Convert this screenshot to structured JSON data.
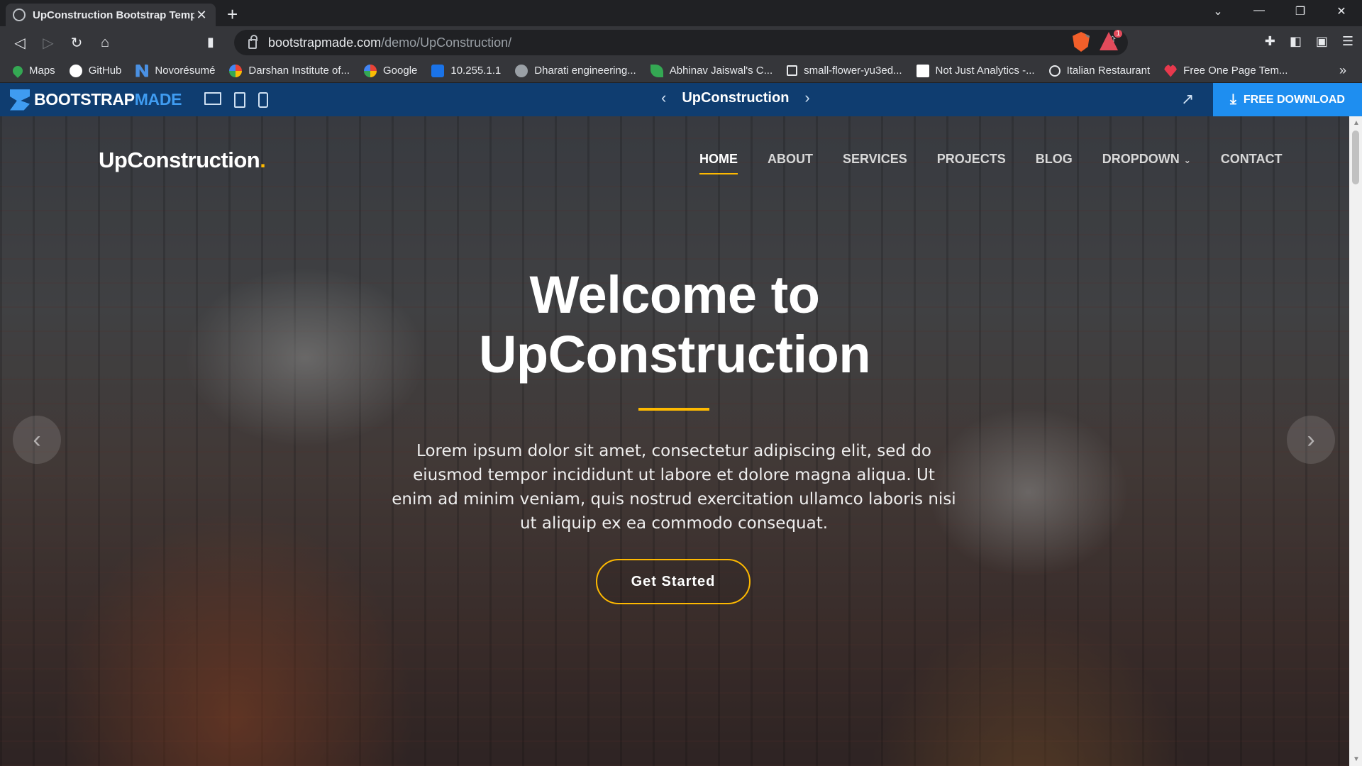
{
  "browser": {
    "tab_title": "UpConstruction Bootstrap Templa",
    "tab_close": "✕",
    "new_tab": "+",
    "url_host": "bootstrapmade.com",
    "url_path": "/demo/UpConstruction/",
    "brave_shield_badge": "1",
    "brave_rewards_badge": "1",
    "window_controls": [
      "⌄",
      "—",
      "❐",
      "✕"
    ],
    "bookmarks": [
      {
        "label": "Maps",
        "icon": "maps-icon",
        "color": "#34a853"
      },
      {
        "label": "GitHub",
        "icon": "github-icon",
        "color": "#ffffff"
      },
      {
        "label": "Novorésumé",
        "icon": "novoresume-icon",
        "color": "#4a90e2"
      },
      {
        "label": "Darshan Institute of...",
        "icon": "google-icon",
        "color": "#ffffff"
      },
      {
        "label": "Google",
        "icon": "google-icon",
        "color": "#ffffff"
      },
      {
        "label": "10.255.1.1",
        "icon": "s-icon",
        "color": "#1a73e8"
      },
      {
        "label": "Dharati engineering...",
        "icon": "globe-icon",
        "color": "#9aa0a6"
      },
      {
        "label": "Abhinav Jaiswal's C...",
        "icon": "leaf-icon",
        "color": "#34a853"
      },
      {
        "label": "small-flower-yu3ed...",
        "icon": "page-icon",
        "color": "#35363a"
      },
      {
        "label": "Not Just Analytics -...",
        "icon": "nja-icon",
        "color": "#ffffff"
      },
      {
        "label": "Italian Restaurant",
        "icon": "clock-icon",
        "color": "#35363a"
      },
      {
        "label": "Free One Page Tem...",
        "icon": "heart-icon",
        "color": "#e8394d"
      }
    ],
    "bookmarks_more": "»"
  },
  "bootstrapmade_bar": {
    "logo_part1": "BOOTSTRAP",
    "logo_part2": "MADE",
    "template_name": "UpConstruction",
    "prev_arrow": "‹",
    "next_arrow": "›",
    "download_label": "FREE DOWNLOAD"
  },
  "site": {
    "logo": "UpConstruction",
    "logo_dot": ".",
    "nav": [
      {
        "label": "HOME",
        "active": true
      },
      {
        "label": "ABOUT"
      },
      {
        "label": "SERVICES"
      },
      {
        "label": "PROJECTS"
      },
      {
        "label": "BLOG"
      },
      {
        "label": "DROPDOWN",
        "caret": "⌄"
      },
      {
        "label": "CONTACT"
      }
    ],
    "hero": {
      "title_line1": "Welcome to",
      "title_line2": "UpConstruction",
      "text": "Lorem ipsum dolor sit amet, consectetur adipiscing elit, sed do eiusmod tempor incididunt ut labore et dolore magna aliqua. Ut enim ad minim veniam, quis nostrud exercitation ullamco laboris nisi ut aliquip ex ea commodo consequat.",
      "cta_label": "Get Started",
      "prev_arrow": "‹",
      "next_arrow": "›"
    },
    "accent_color": "#feb900"
  }
}
